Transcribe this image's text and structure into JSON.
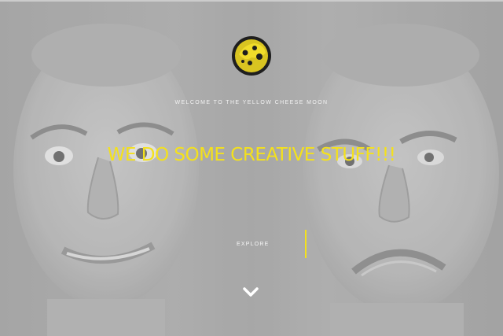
{
  "hero": {
    "welcome_text": "WELCOME TO THE YELLOW CHEESE MOON",
    "headline": "WE DO SOME CREATIVE STUFF!!!",
    "explore_label": "EXPLORE"
  },
  "icons": {
    "logo": "cheese-moon-logo",
    "scroll": "chevron-down-icon"
  },
  "colors": {
    "accent": "#f4e11c",
    "logo_ring": "#1e1e1e",
    "logo_fill": "#d9c421"
  }
}
